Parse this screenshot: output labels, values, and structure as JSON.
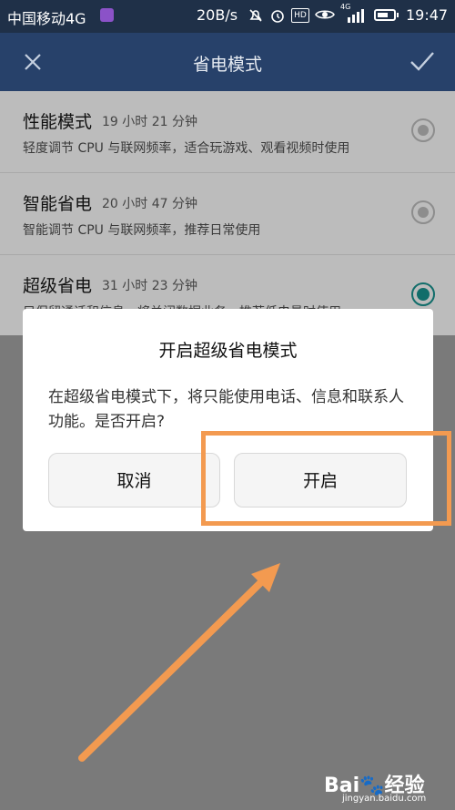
{
  "status_bar": {
    "carrier": "中国移动4G",
    "net_speed": "20B/s",
    "hd_label": "HD",
    "signal_label": "4G",
    "time": "19:47",
    "icons": [
      "app-notification-icon",
      "mute-icon",
      "alarm-icon",
      "hd-icon",
      "eye-icon",
      "signal-icon",
      "battery-icon"
    ]
  },
  "title_bar": {
    "title": "省电模式",
    "close_icon": "close-icon",
    "confirm_icon": "check-icon"
  },
  "modes": [
    {
      "name": "性能模式",
      "duration": "19 小时 21 分钟",
      "description": "轻度调节 CPU 与联网频率，适合玩游戏、观看视频时使用",
      "selected": false
    },
    {
      "name": "智能省电",
      "duration": "20 小时 47 分钟",
      "description": "智能调节 CPU 与联网频率，推荐日常使用",
      "selected": false
    },
    {
      "name": "超级省电",
      "duration": "31 小时 23 分钟",
      "description": "只保留通话和信息，将关闭数据业务，推荐低电量时使用",
      "selected": true
    }
  ],
  "dialog": {
    "title": "开启超级省电模式",
    "message": "在超级省电模式下，将只能使用电话、信息和联系人功能。是否开启?",
    "cancel_label": "取消",
    "confirm_label": "开启"
  },
  "annotation": {
    "highlight_color": "#f39a50"
  },
  "watermark": {
    "logo_text": "Bai🐾经验",
    "url": "jingyan.baidu.com"
  },
  "colors": {
    "status_bar": "#1f3048",
    "title_bar": "#27416a",
    "radio_selected": "#116d6a",
    "list_background_dimmed": "#bcbcbc"
  }
}
